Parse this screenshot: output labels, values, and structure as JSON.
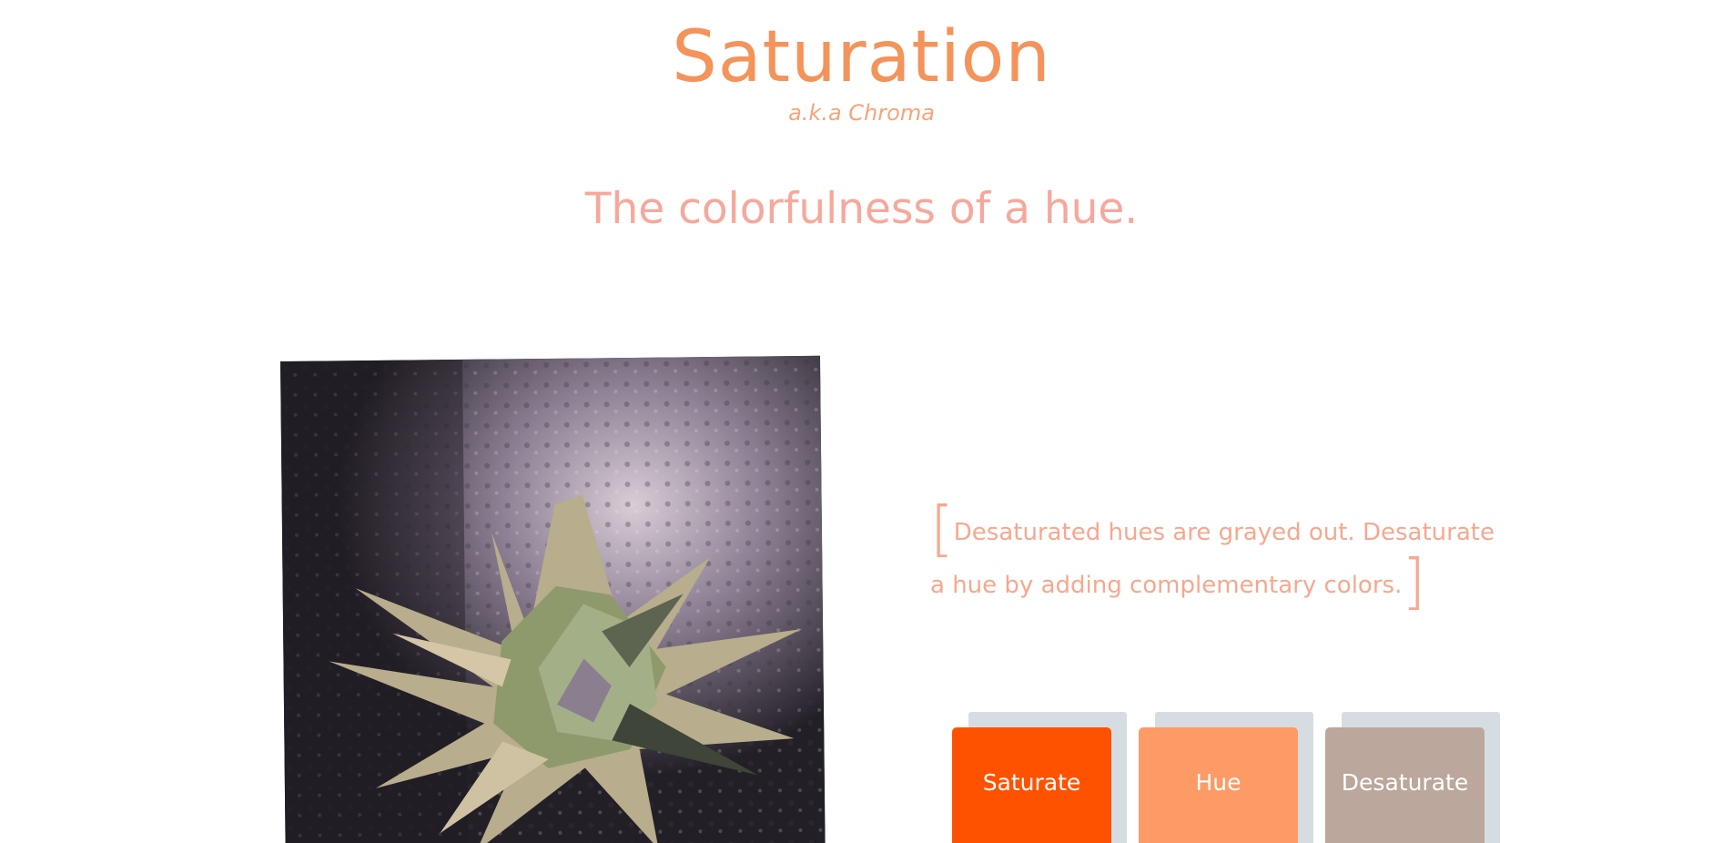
{
  "header": {
    "title": "Saturation",
    "subtitle": "a.k.a Chroma",
    "tagline": "The colorfulness of a hue."
  },
  "quote": {
    "open_bracket": "[",
    "text": "Desaturated hues are grayed out. Desaturate a hue by adding complementary colors.",
    "close_bracket": "]"
  },
  "swatches": [
    {
      "label": "Saturate",
      "color": "#ff5200"
    },
    {
      "label": "Hue",
      "color": "#fd9a66"
    },
    {
      "label": "Desaturate",
      "color": "#bba79b"
    }
  ],
  "colors": {
    "title": "#f4935a",
    "tagline": "#f6a89c",
    "swatch_shadow": "#d6dde2"
  },
  "artwork": {
    "icon": "spiky-polygon-sculpture-image"
  }
}
